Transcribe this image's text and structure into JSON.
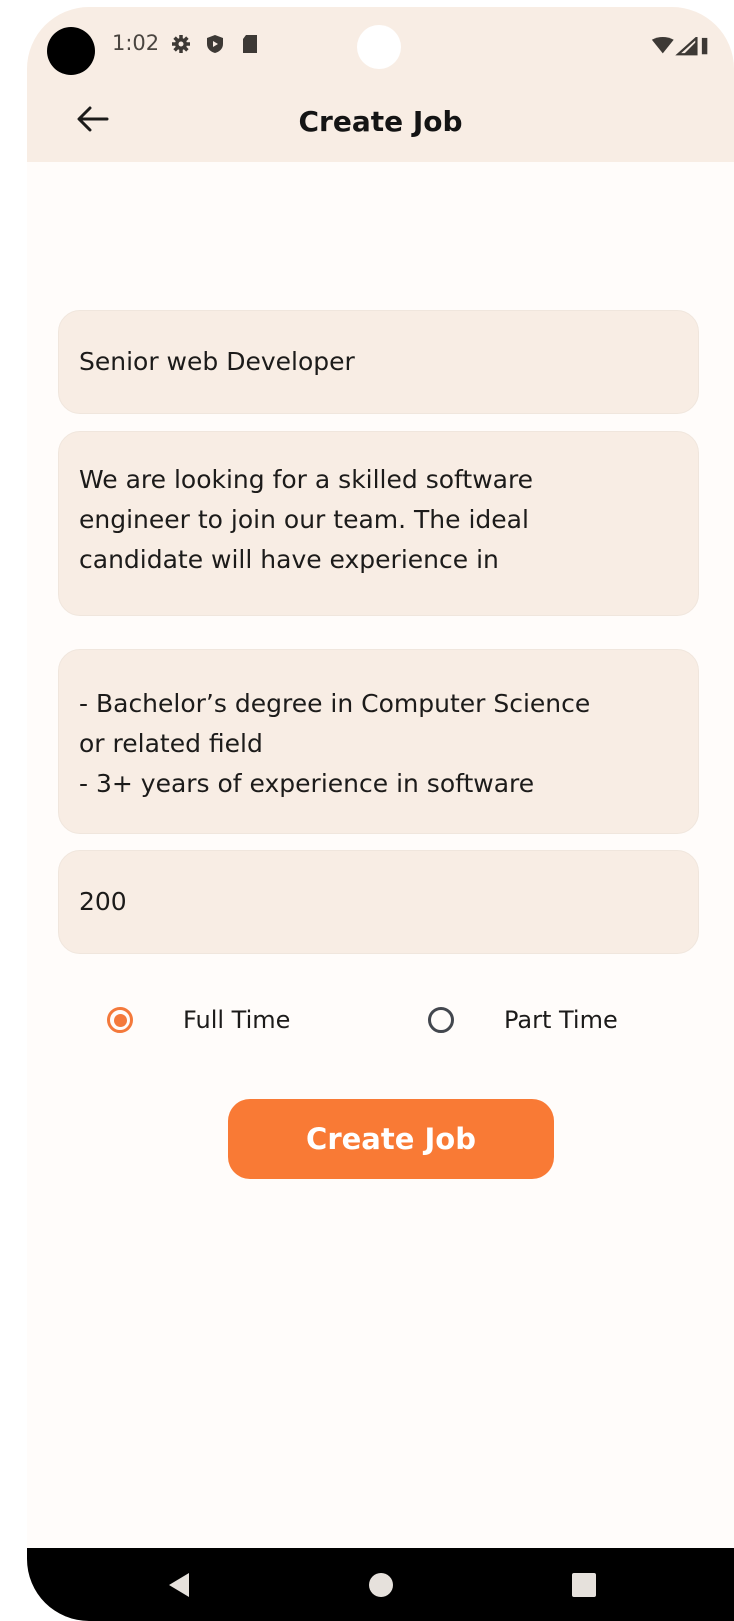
{
  "status_bar": {
    "time": "1:02",
    "icons": [
      "gear-icon",
      "shield-icon",
      "sd-card-icon"
    ],
    "right_icons": [
      "wifi-icon",
      "signal-icon",
      "battery-icon"
    ]
  },
  "header": {
    "back_icon": "arrow-left-icon",
    "title": "Create Job"
  },
  "form": {
    "job_title_value": "Senior web Developer",
    "description_value": "We are looking for a skilled software\nengineer to join our team. The ideal\ncandidate will have experience in",
    "requirements_value": "- Bachelor’s degree in Computer Science\nor related field\n- 3+ years of experience in software",
    "salary_value": "200",
    "job_type": {
      "options": [
        {
          "label": "Full Time",
          "selected": true
        },
        {
          "label": "Part Time",
          "selected": false
        }
      ]
    },
    "submit_label": "Create Job"
  },
  "nav_bar": {
    "buttons": [
      "back-triangle-icon",
      "home-circle-icon",
      "recents-square-icon"
    ]
  },
  "colors": {
    "app_bar_bg": "#f8ede4",
    "field_bg": "#f8ede4",
    "accent": "#f97a35",
    "radio_selected": "#f4793b",
    "text": "#1c1b1a"
  }
}
